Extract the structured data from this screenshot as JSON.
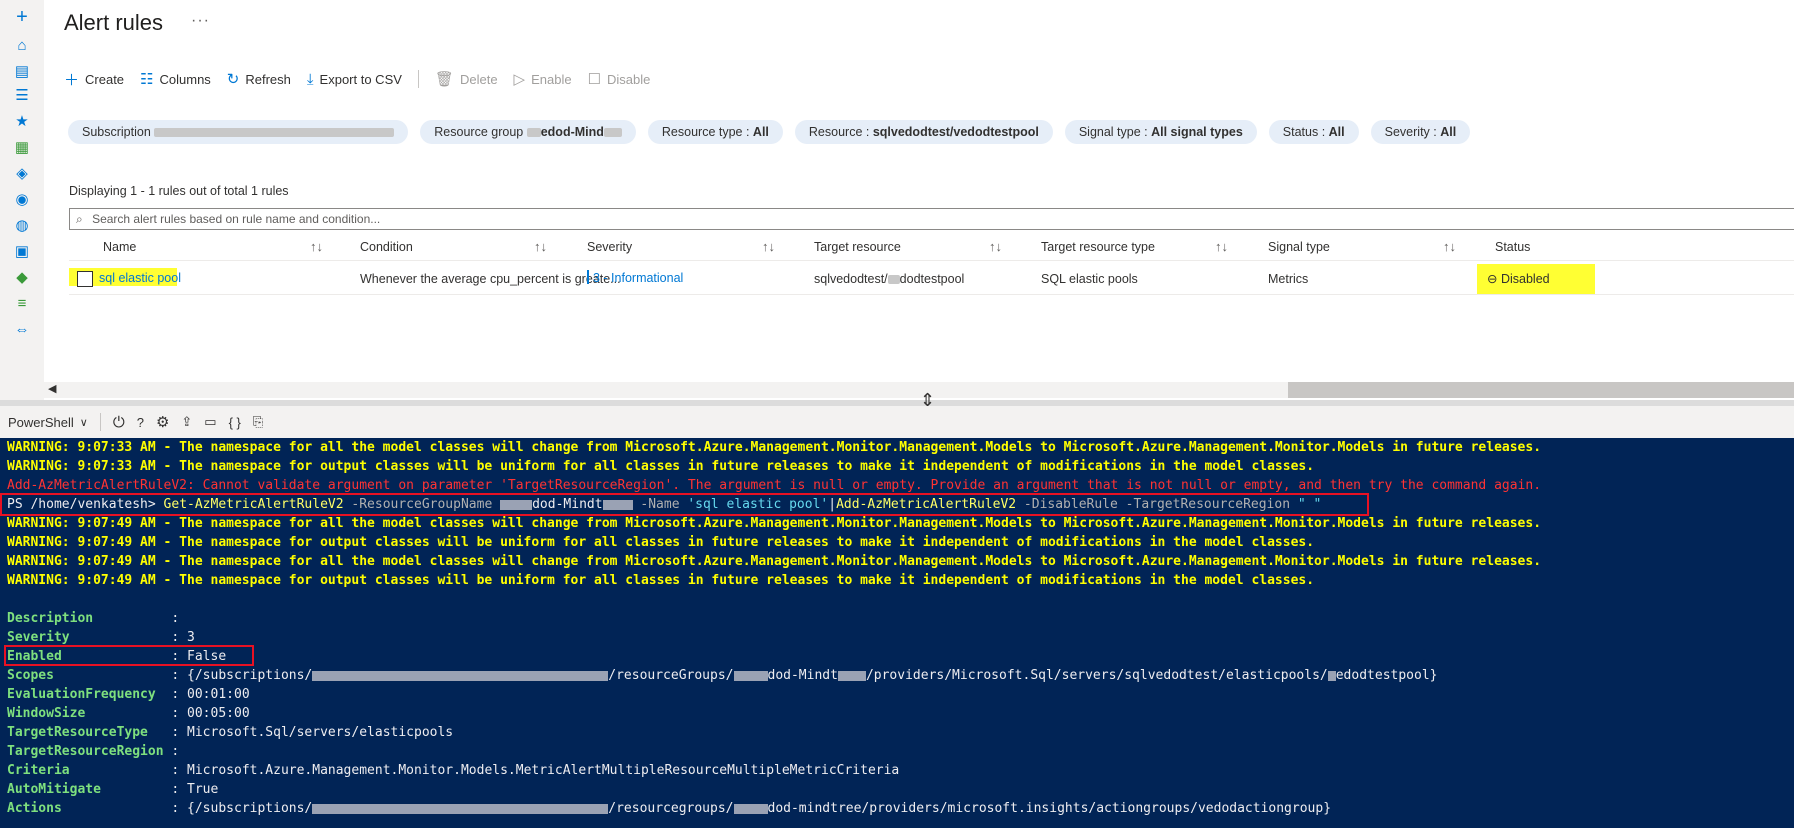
{
  "sidebar": {
    "icons": [
      "plus-icon",
      "home-icon",
      "dashboard-icon",
      "list-icon",
      "star-icon",
      "grid-icon",
      "cube-icon",
      "globe-icon",
      "sql-icon",
      "monitor-icon",
      "diamond-icon",
      "bars-icon",
      "network-icon"
    ]
  },
  "page": {
    "title": "Alert rules",
    "more": "···"
  },
  "toolbar": {
    "create": "Create",
    "columns": "Columns",
    "refresh": "Refresh",
    "export": "Export to CSV",
    "delete": "Delete",
    "enable": "Enable",
    "disable": "Disable"
  },
  "filters": {
    "subscription_label": "Subscription",
    "resource_group_label": "Resource group",
    "resource_group_value": "edod-Mind",
    "resource_type_label": "Resource type : ",
    "resource_type_value": "All",
    "resource_label": "Resource : ",
    "resource_value": "sqlvedodtest/vedodtestpool",
    "signal_type_label": "Signal type : ",
    "signal_type_value": "All signal types",
    "status_label": "Status : ",
    "status_value": "All",
    "severity_label": "Severity : ",
    "severity_value": "All"
  },
  "list": {
    "count_text": "Displaying 1 - 1 rules out of total 1 rules",
    "search_placeholder": "Search alert rules based on rule name and condition...",
    "columns": [
      "Name",
      "Condition",
      "Severity",
      "Target resource",
      "Target resource type",
      "Signal type",
      "Status"
    ],
    "rows": [
      {
        "name": "sql elastic pool",
        "condition": "Whenever the average cpu_percent is greate...",
        "severity": "3 - Informational",
        "target_resource": "sqlvedodtest/",
        "target_resource_tail": "dodtestpool",
        "target_type": "SQL elastic pools",
        "signal_type": "Metrics",
        "status": "Disabled"
      }
    ]
  },
  "shell": {
    "name": "PowerShell"
  },
  "terminal": {
    "warn1": "WARNING: 9:07:33 AM - The namespace for all the model classes will change from Microsoft.Azure.Management.Monitor.Management.Models to Microsoft.Azure.Management.Monitor.Models in future releases.",
    "warn2": "WARNING: 9:07:33 AM - The namespace for output classes will be uniform for all classes in future releases to make it independent of modifications in the model classes.",
    "error": "Add-AzMetricAlertRuleV2: Cannot validate argument on parameter 'TargetResourceRegion'. The argument is null or empty. Provide an argument that is not null or empty, and then try the command again.",
    "prompt": "PS /home/venkatesh> ",
    "cmd1": "Get-AzMetricAlertRuleV2",
    "p1": " -ResourceGroupName ",
    "rg": "dod-Mindt",
    "p2": " -Name ",
    "s1": "'sql elastic pool'",
    "pipe": "|",
    "cmd2": "Add-AzMetricAlertRuleV2",
    "p3": " -DisableRule -TargetResourceRegion ",
    "s2": "\" \"",
    "warn3": "WARNING: 9:07:49 AM - The namespace for all the model classes will change from Microsoft.Azure.Management.Monitor.Management.Models to Microsoft.Azure.Management.Monitor.Models in future releases.",
    "warn4": "WARNING: 9:07:49 AM - The namespace for output classes will be uniform for all classes in future releases to make it independent of modifications in the model classes.",
    "warn5": "WARNING: 9:07:49 AM - The namespace for all the model classes will change from Microsoft.Azure.Management.Monitor.Management.Models to Microsoft.Azure.Management.Monitor.Models in future releases.",
    "warn6": "WARNING: 9:07:49 AM - The namespace for output classes will be uniform for all classes in future releases to make it independent of modifications in the model classes.",
    "props": [
      {
        "key": "Description          ",
        "val": ": "
      },
      {
        "key": "Severity             ",
        "val": ": 3"
      },
      {
        "key": "Enabled              ",
        "val": ": False"
      },
      {
        "key": "Scopes               ",
        "val": ": {/subscriptions/",
        "val2": "/resourceGroups/",
        "val3": "dod-Mindt",
        "val4": "/providers/Microsoft.Sql/servers/sqlvedodtest/elasticpools/",
        "val5": "edodtestpool}"
      },
      {
        "key": "EvaluationFrequency  ",
        "val": ": 00:01:00"
      },
      {
        "key": "WindowSize           ",
        "val": ": 00:05:00"
      },
      {
        "key": "TargetResourceType   ",
        "val": ": Microsoft.Sql/servers/elasticpools"
      },
      {
        "key": "TargetResourceRegion ",
        "val": ": "
      },
      {
        "key": "Criteria             ",
        "val": ": Microsoft.Azure.Management.Monitor.Models.MetricAlertMultipleResourceMultipleMetricCriteria"
      },
      {
        "key": "AutoMitigate         ",
        "val": ": True"
      },
      {
        "key": "Actions              ",
        "val": ": {/subscriptions/",
        "val2": "/resourcegroups/",
        "val3": "dod-mindtree",
        "val4": "/providers/microsoft.insights/actiongroups/vedodactiongroup}"
      }
    ]
  }
}
